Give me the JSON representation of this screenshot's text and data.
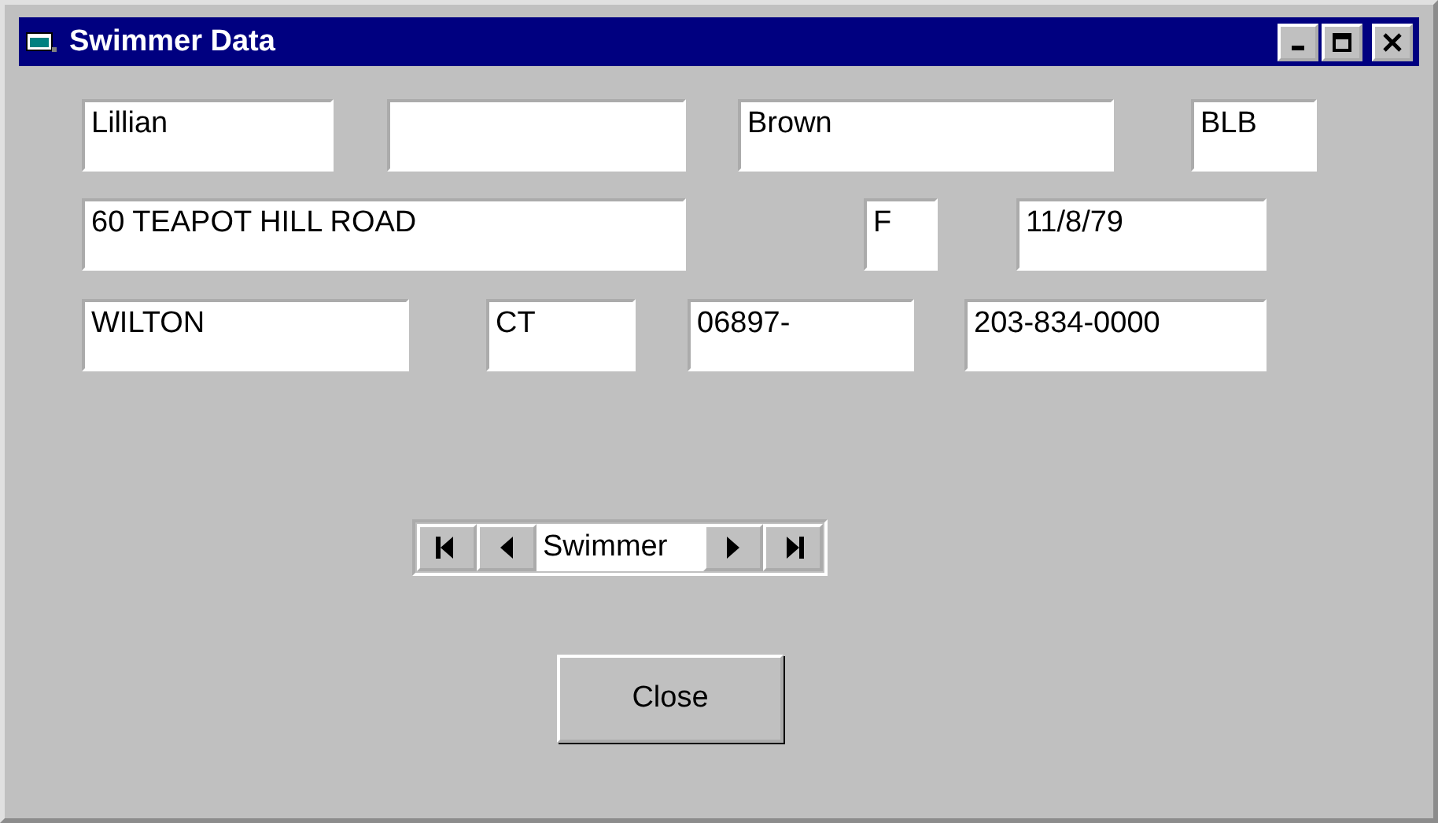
{
  "window": {
    "title": "Swimmer Data"
  },
  "field_rows": [
    [
      {
        "value": "Lillian"
      },
      {},
      {
        "value": "Brown"
      },
      {
        "value": "BLB"
      }
    ],
    [
      {
        "value": "60 TEAPOT HILL ROAD"
      },
      {
        "value": "F"
      },
      {
        "value": "11/8/79"
      }
    ],
    [
      {
        "value": "WILTON"
      },
      {
        "value": "CT"
      },
      {
        "value": "06897-"
      },
      {
        "value": "203-834-0000"
      }
    ]
  ],
  "navigator": {
    "caption": "Swimmer"
  },
  "buttons": [
    "Close"
  ]
}
